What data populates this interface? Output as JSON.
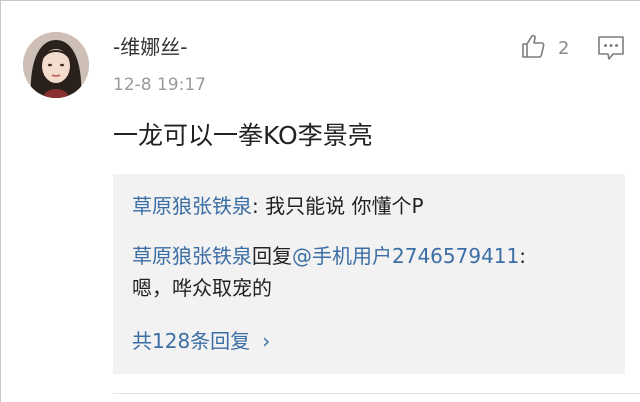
{
  "comment": {
    "username": "-维娜丝-",
    "timestamp": "12-8 19:17",
    "like_count": "2",
    "text": "一龙可以一拳KO李景亮",
    "icons": {
      "avatar": "user-avatar",
      "like": "thumbs-up-icon",
      "reply": "comment-bubble-icon"
    }
  },
  "replies": [
    {
      "author": "草原狼张铁泉",
      "separator": ": ",
      "text": "我只能说 你懂个P"
    },
    {
      "author": "草原狼张铁泉",
      "action": "回复",
      "target": "@手机用户2746579411",
      "separator": ": ",
      "text": "嗯，哗众取宠的"
    }
  ],
  "more_replies": {
    "label": "共128条回复",
    "icon": "chevron-right-icon",
    "chevron": "›"
  },
  "colors": {
    "link": "#3b6ea5",
    "reply_background": "#f2f2f2",
    "secondary_text": "#9a9a9a"
  }
}
